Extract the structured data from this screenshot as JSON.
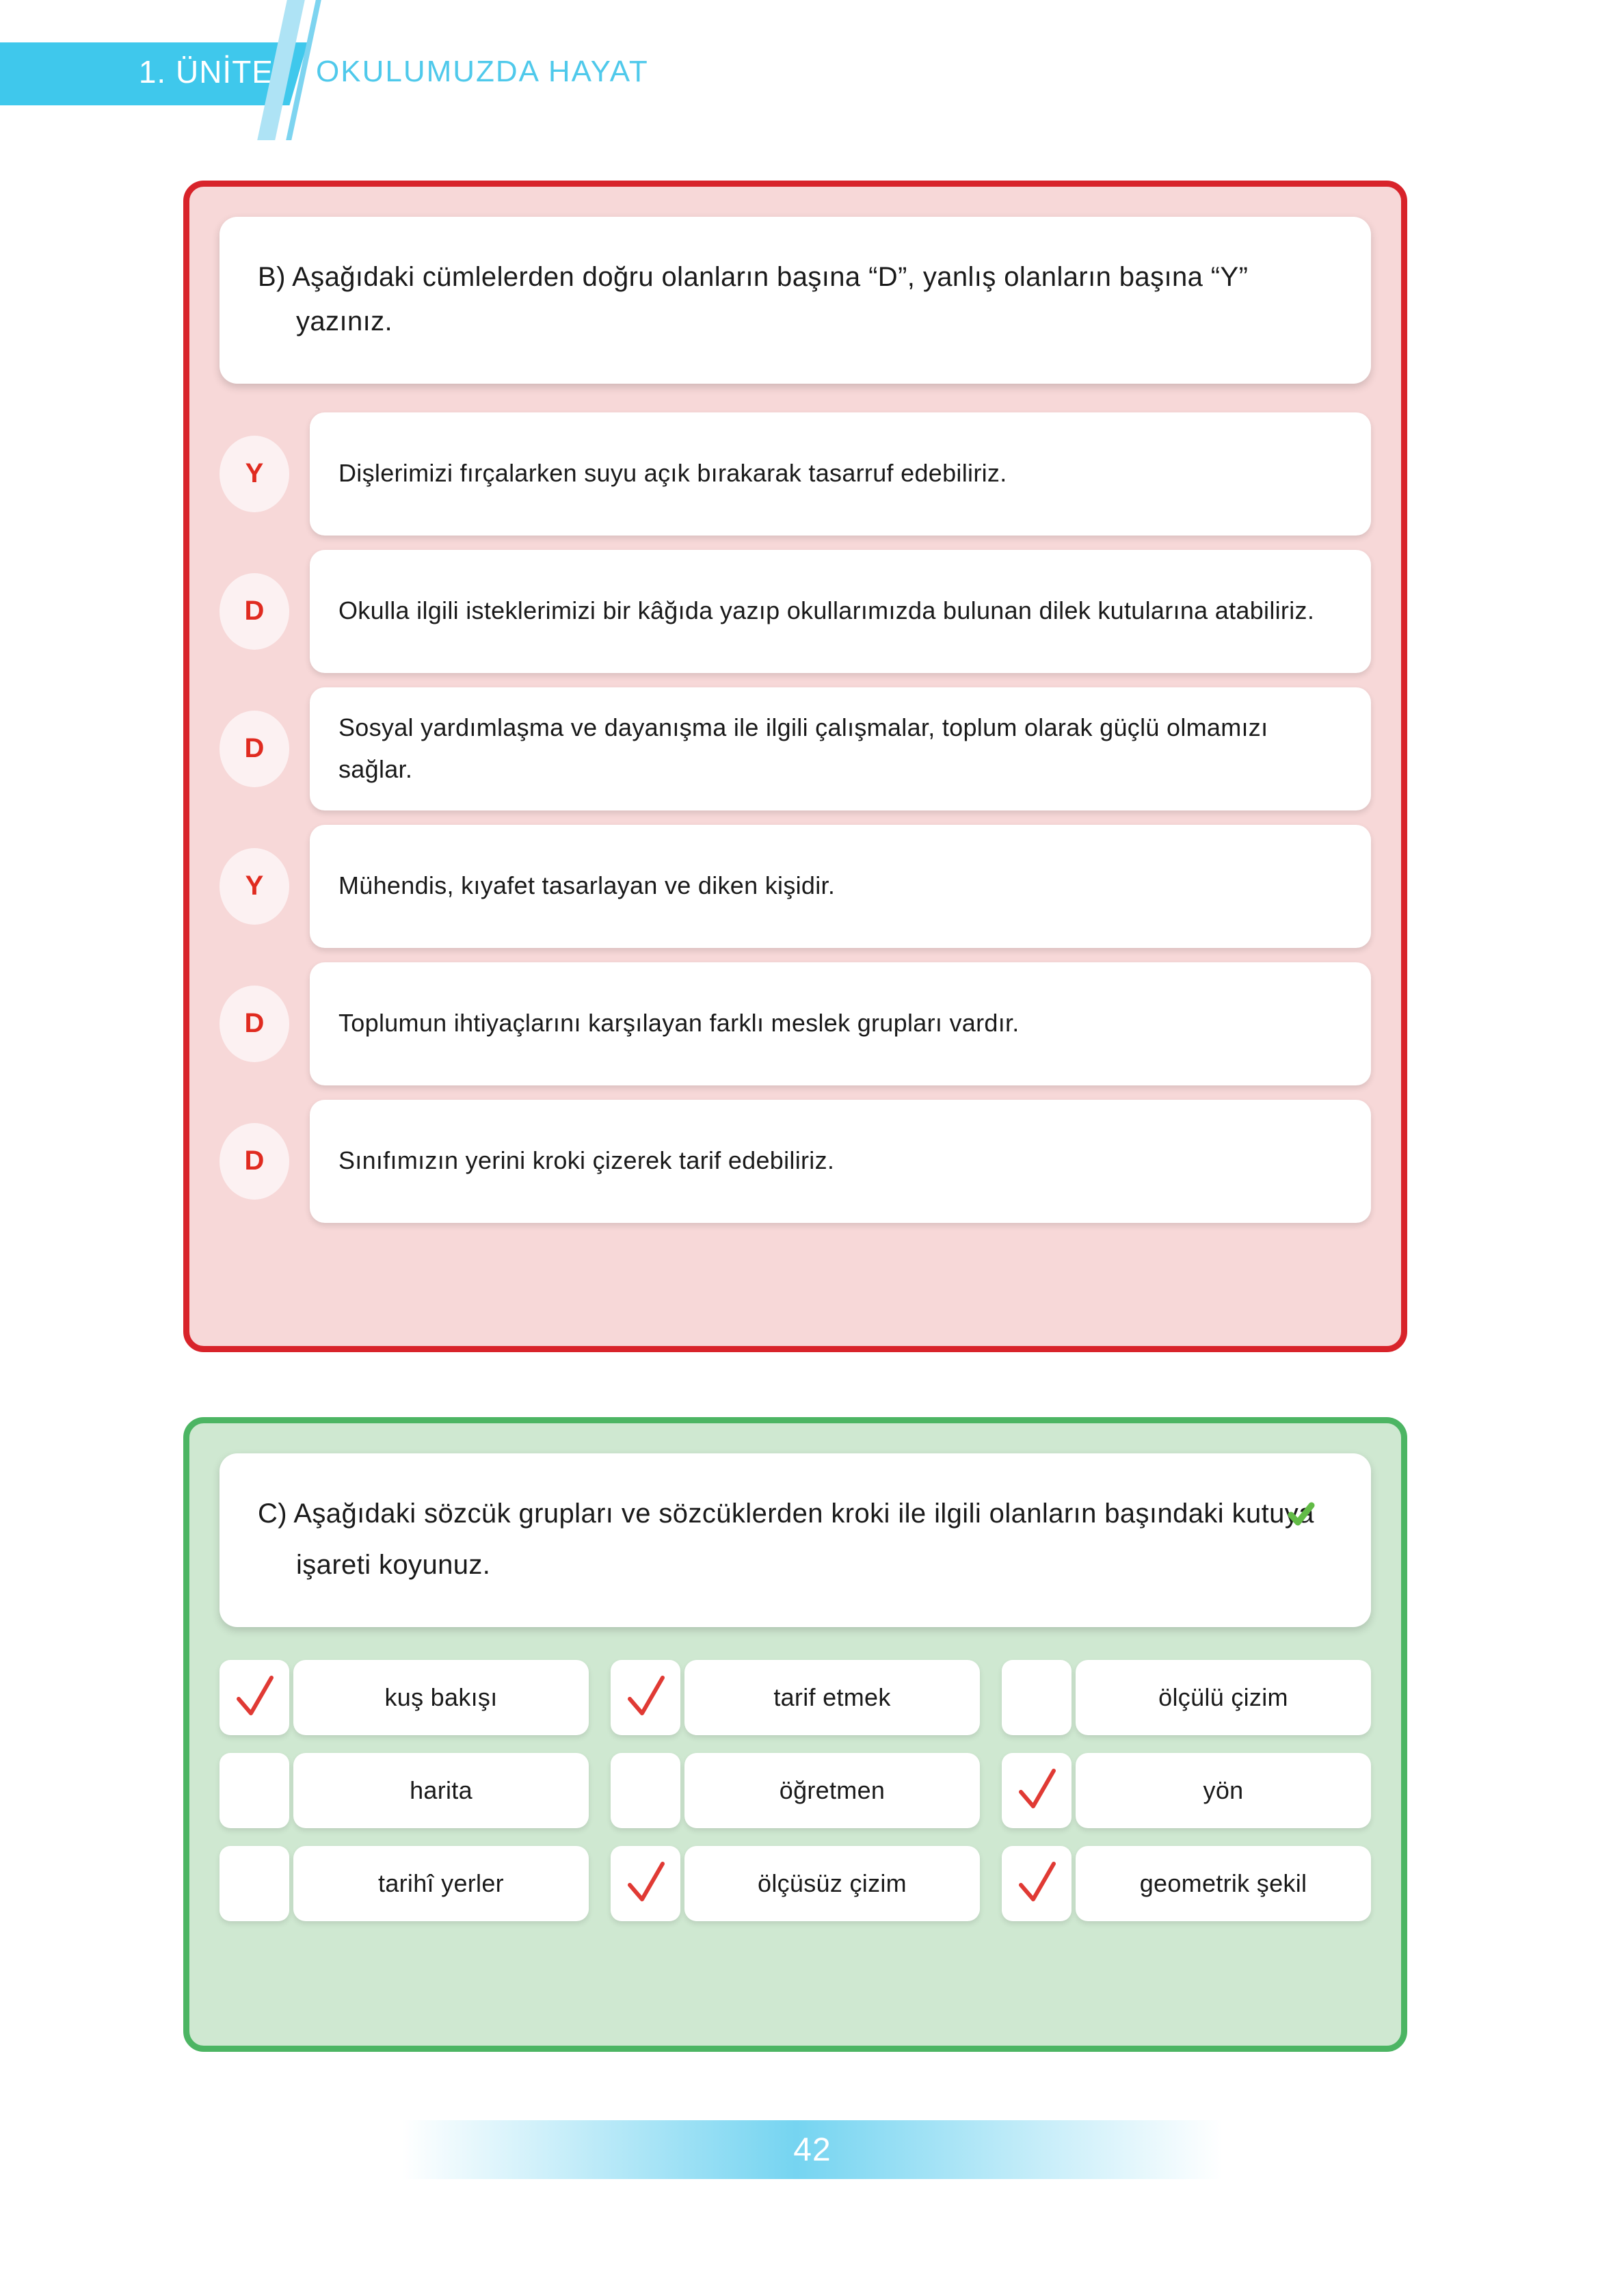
{
  "header": {
    "unit_label": "1. ÜNİTE",
    "unit_title": "OKULUMUZDA HAYAT",
    "band_color": "#3FC8EC",
    "title_color": "#4FC9EB"
  },
  "section_b": {
    "border_color": "#D8232A",
    "fill_color": "#F7D8D8",
    "prompt": "B)  Aşağıdaki cümlelerden doğru olanların başına “D”, yanlış olanların başına “Y” yazınız.",
    "marker_color": "#E02B20",
    "items": [
      {
        "answer": "Y",
        "text": "Dişlerimizi fırçalarken suyu açık bırakarak tasarruf edebiliriz."
      },
      {
        "answer": "D",
        "text": "Okulla ilgili isteklerimizi bir kâğıda yazıp okullarımızda bulunan dilek kutularına atabiliriz."
      },
      {
        "answer": "D",
        "text": "Sosyal yardımlaşma ve dayanışma ile ilgili çalışmalar, toplum olarak güçlü olmamızı sağlar."
      },
      {
        "answer": "Y",
        "text": "Mühendis, kıyafet tasarlayan ve diken kişidir."
      },
      {
        "answer": "D",
        "text": "Toplumun ihtiyaçlarını karşılayan farklı meslek grupları vardır."
      },
      {
        "answer": "D",
        "text": "Sınıfımızın yerini kroki çizerek tarif edebiliriz."
      }
    ]
  },
  "section_c": {
    "border_color": "#4CB563",
    "fill_color": "#CFE8D1",
    "prompt_before": "C)  Aşağıdaki sözcük grupları ve sözcüklerden kroki ile ilgili olanların başındaki kutuya ",
    "prompt_after": " işareti koyunuz.",
    "check_color": "#E03A34",
    "inline_check_color": "#62BB46",
    "rows": [
      [
        {
          "label": "kuş bakışı",
          "checked": true
        },
        {
          "label": "tarif etmek",
          "checked": true
        },
        {
          "label": "ölçülü çizim",
          "checked": false
        }
      ],
      [
        {
          "label": "harita",
          "checked": false
        },
        {
          "label": "öğretmen",
          "checked": false
        },
        {
          "label": "yön",
          "checked": true
        }
      ],
      [
        {
          "label": "tarihî yerler",
          "checked": false
        },
        {
          "label": "ölçüsüz çizim",
          "checked": true
        },
        {
          "label": "geometrik şekil",
          "checked": true
        }
      ]
    ]
  },
  "footer": {
    "page_number": "42"
  }
}
